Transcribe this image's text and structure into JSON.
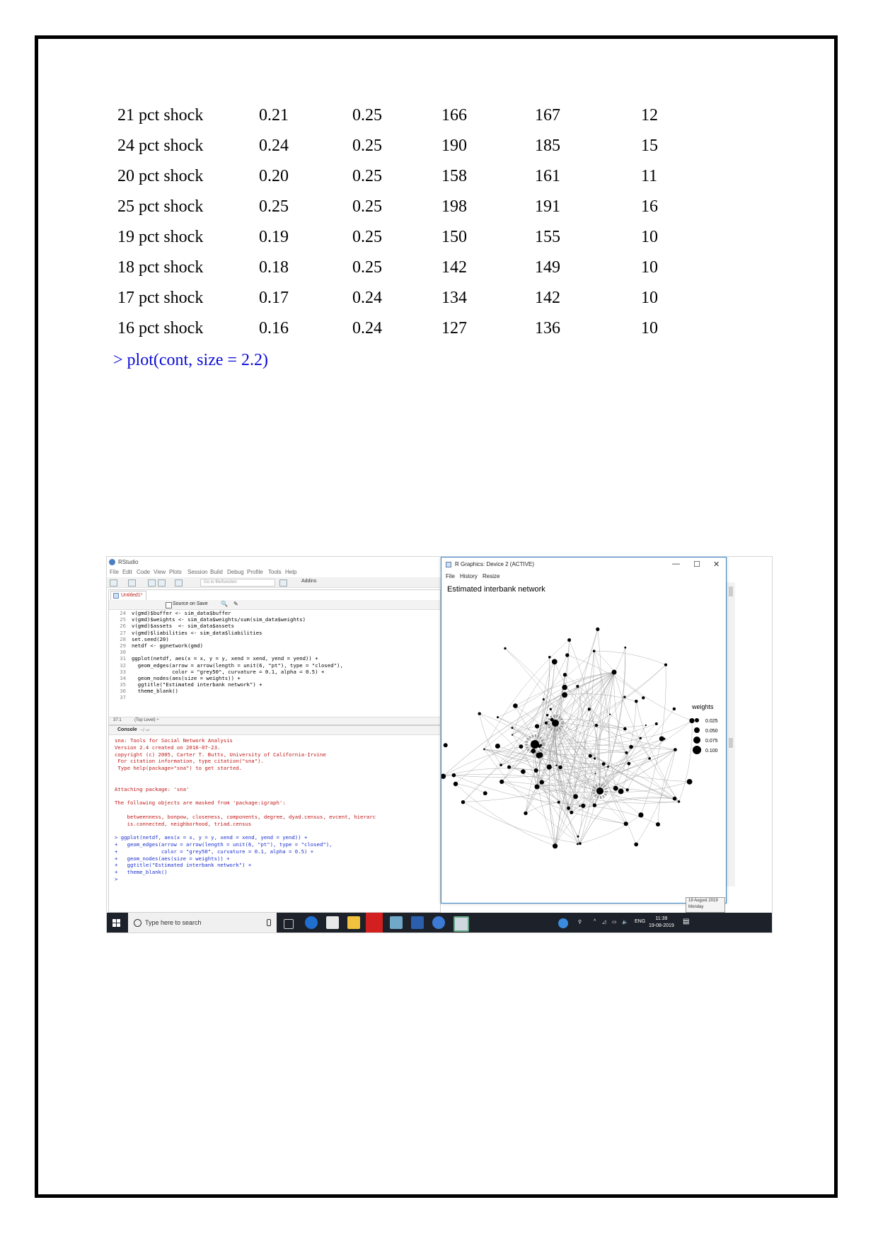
{
  "table": {
    "rows": [
      [
        "21 pct shock",
        "0.21",
        "0.25",
        "166",
        "167",
        "12"
      ],
      [
        "24 pct shock",
        "0.24",
        "0.25",
        "190",
        "185",
        "15"
      ],
      [
        "20 pct shock",
        "0.20",
        "0.25",
        "158",
        "161",
        "11"
      ],
      [
        "25 pct shock",
        "0.25",
        "0.25",
        "198",
        "191",
        "16"
      ],
      [
        "19 pct shock",
        "0.19",
        "0.25",
        "150",
        "155",
        "10"
      ],
      [
        "18 pct shock",
        "0.18",
        "0.25",
        "142",
        "149",
        "10"
      ],
      [
        "17 pct shock",
        "0.17",
        "0.24",
        "134",
        "142",
        "10"
      ],
      [
        "16 pct shock",
        "0.16",
        "0.24",
        "127",
        "136",
        "10"
      ]
    ],
    "command": "> plot(cont, size = 2.2)"
  },
  "rstudio": {
    "title": "RStudio",
    "menu": [
      "File",
      "Edit",
      "Code",
      "View",
      "Plots",
      "Session",
      "Build",
      "Debug",
      "Profile",
      "Tools",
      "Help"
    ],
    "goto_placeholder": "Go to file/function",
    "addins": "Addins",
    "editor_tab": "Untitled1*",
    "source_on_save": "Source on Save",
    "code_lines": [
      {
        "n": "24",
        "t": "v(gmd)$buffer <- sim_data$buffer"
      },
      {
        "n": "25",
        "t": "v(gmd)$weights <- sim_data$weights/sum(sim_data$weights)"
      },
      {
        "n": "26",
        "t": "v(gmd)$assets  <- sim_data$assets"
      },
      {
        "n": "27",
        "t": "v(gmd)$liabilities <- sim_data$liabilities"
      },
      {
        "n": "28",
        "t": "set.seed(20)"
      },
      {
        "n": "29",
        "t": "netdf <- ggnetwork(gmd)"
      },
      {
        "n": "30",
        "t": ""
      },
      {
        "n": "31",
        "t": "ggplot(netdf, aes(x = x, y = y, xend = xend, yend = yend)) +"
      },
      {
        "n": "32",
        "t": "  geom_edges(arrow = arrow(length = unit(6, \"pt\"), type = \"closed\"),"
      },
      {
        "n": "33",
        "t": "             color = \"grey50\", curvature = 0.1, alpha = 0.5) +"
      },
      {
        "n": "34",
        "t": "  geom_nodes(aes(size = weights)) +"
      },
      {
        "n": "35",
        "t": "  ggtitle(\"Estimated interbank network\") +"
      },
      {
        "n": "36",
        "t": "  theme_blank()"
      },
      {
        "n": "37",
        "t": ""
      }
    ],
    "editor_status_pos": "37:1",
    "editor_status_level": "(Top Level) ÷",
    "console_label": "Console",
    "console_path": "~/ ⇨",
    "console_lines": [
      {
        "c": "red",
        "t": "sna: Tools for Social Network Analysis"
      },
      {
        "c": "red",
        "t": "Version 2.4 created on 2016-07-23."
      },
      {
        "c": "red",
        "t": "copyright (c) 2005, Carter T. Butts, University of California-Irvine"
      },
      {
        "c": "red",
        "t": " For citation information, type citation(\"sna\")."
      },
      {
        "c": "red",
        "t": " Type help(package=\"sna\") to get started."
      },
      {
        "c": "red",
        "t": ""
      },
      {
        "c": "red",
        "t": ""
      },
      {
        "c": "red",
        "t": "Attaching package: 'sna'"
      },
      {
        "c": "red",
        "t": ""
      },
      {
        "c": "red",
        "t": "The following objects are masked from 'package:igraph':"
      },
      {
        "c": "red",
        "t": ""
      },
      {
        "c": "red",
        "t": "    betweenness, bonpow, closeness, components, degree, dyad.census, evcent, hierarc"
      },
      {
        "c": "red",
        "t": "    is.connected, neighborhood, triad.census"
      },
      {
        "c": "red",
        "t": ""
      },
      {
        "c": "blue",
        "t": "> ggplot(netdf, aes(x = x, y = y, xend = xend, yend = yend)) +"
      },
      {
        "c": "blue",
        "t": "+   geom_edges(arrow = arrow(length = unit(6, \"pt\"), type = \"closed\"),"
      },
      {
        "c": "blue",
        "t": "+              color = \"grey50\", curvature = 0.1, alpha = 0.5) +"
      },
      {
        "c": "blue",
        "t": "+   geom_nodes(aes(size = weights)) +"
      },
      {
        "c": "blue",
        "t": "+   ggtitle(\"Estimated interbank network\") +"
      },
      {
        "c": "blue",
        "t": "+   theme_blank()"
      },
      {
        "c": "blue",
        "t": "> "
      }
    ]
  },
  "graphics_window": {
    "title": "R Graphics: Device 2 (ACTIVE)",
    "menu": [
      "File",
      "History",
      "Resize"
    ],
    "minimize": "—",
    "maximize": "☐",
    "close": "✕",
    "plot_title": "Estimated interbank network",
    "legend_title": "weights",
    "legend_items": [
      "0.025",
      "0.050",
      "0.075",
      "0.100"
    ]
  },
  "taskbar": {
    "search_placeholder": "Type here to search",
    "language": "ENG",
    "time": "11:39",
    "date": "19-08-2019",
    "notification_line1": "19 August 2019",
    "notification_line2": "Monday"
  },
  "colors": {
    "command_blue": "#0b0bd8",
    "console_red": "#c01818",
    "console_blue": "#1a2fd0",
    "taskbar": "#1d2129",
    "window_border": "#3a86c8"
  }
}
